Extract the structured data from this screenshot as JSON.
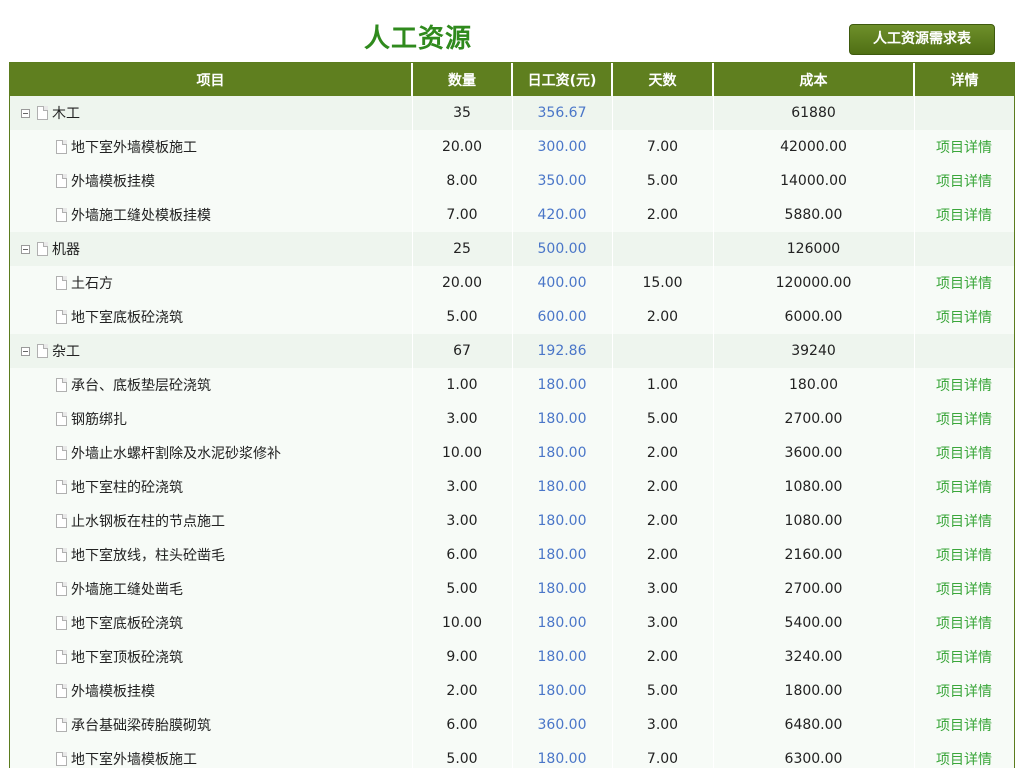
{
  "page": {
    "title": "人工资源",
    "demand_button": "人工资源需求表"
  },
  "table": {
    "headers": {
      "item": "项目",
      "quantity": "数量",
      "daily_wage": "日工资(元)",
      "days": "天数",
      "cost": "成本",
      "detail": "详情"
    },
    "detail_link_text": "项目详情",
    "rows": [
      {
        "type": "group",
        "name": "木工",
        "quantity": "35",
        "wage": "356.67",
        "days": "",
        "cost": "61880"
      },
      {
        "type": "child",
        "name": "地下室外墙模板施工",
        "quantity": "20.00",
        "wage": "300.00",
        "days": "7.00",
        "cost": "42000.00"
      },
      {
        "type": "child",
        "name": "外墙模板挂模",
        "quantity": "8.00",
        "wage": "350.00",
        "days": "5.00",
        "cost": "14000.00"
      },
      {
        "type": "child",
        "name": "外墙施工缝处模板挂模",
        "quantity": "7.00",
        "wage": "420.00",
        "days": "2.00",
        "cost": "5880.00"
      },
      {
        "type": "group",
        "name": "机器",
        "quantity": "25",
        "wage": "500.00",
        "days": "",
        "cost": "126000"
      },
      {
        "type": "child",
        "name": "土石方",
        "quantity": "20.00",
        "wage": "400.00",
        "days": "15.00",
        "cost": "120000.00"
      },
      {
        "type": "child",
        "name": "地下室底板砼浇筑",
        "quantity": "5.00",
        "wage": "600.00",
        "days": "2.00",
        "cost": "6000.00"
      },
      {
        "type": "group",
        "name": "杂工",
        "quantity": "67",
        "wage": "192.86",
        "days": "",
        "cost": "39240"
      },
      {
        "type": "child",
        "name": "承台、底板垫层砼浇筑",
        "quantity": "1.00",
        "wage": "180.00",
        "days": "1.00",
        "cost": "180.00"
      },
      {
        "type": "child",
        "name": "钢筋绑扎",
        "quantity": "3.00",
        "wage": "180.00",
        "days": "5.00",
        "cost": "2700.00"
      },
      {
        "type": "child",
        "name": "外墙止水螺杆割除及水泥砂浆修补",
        "quantity": "10.00",
        "wage": "180.00",
        "days": "2.00",
        "cost": "3600.00"
      },
      {
        "type": "child",
        "name": "地下室柱的砼浇筑",
        "quantity": "3.00",
        "wage": "180.00",
        "days": "2.00",
        "cost": "1080.00"
      },
      {
        "type": "child",
        "name": "止水钢板在柱的节点施工",
        "quantity": "3.00",
        "wage": "180.00",
        "days": "2.00",
        "cost": "1080.00"
      },
      {
        "type": "child",
        "name": "地下室放线，柱头砼凿毛",
        "quantity": "6.00",
        "wage": "180.00",
        "days": "2.00",
        "cost": "2160.00"
      },
      {
        "type": "child",
        "name": "外墙施工缝处凿毛",
        "quantity": "5.00",
        "wage": "180.00",
        "days": "3.00",
        "cost": "2700.00"
      },
      {
        "type": "child",
        "name": "地下室底板砼浇筑",
        "quantity": "10.00",
        "wage": "180.00",
        "days": "3.00",
        "cost": "5400.00"
      },
      {
        "type": "child",
        "name": "地下室顶板砼浇筑",
        "quantity": "9.00",
        "wage": "180.00",
        "days": "2.00",
        "cost": "3240.00"
      },
      {
        "type": "child",
        "name": "外墙模板挂模",
        "quantity": "2.00",
        "wage": "180.00",
        "days": "5.00",
        "cost": "1800.00"
      },
      {
        "type": "child",
        "name": "承台基础梁砖胎膜砌筑",
        "quantity": "6.00",
        "wage": "360.00",
        "days": "3.00",
        "cost": "6480.00"
      },
      {
        "type": "child",
        "name": "地下室外墙模板施工",
        "quantity": "5.00",
        "wage": "180.00",
        "days": "7.00",
        "cost": "6300.00"
      }
    ]
  }
}
